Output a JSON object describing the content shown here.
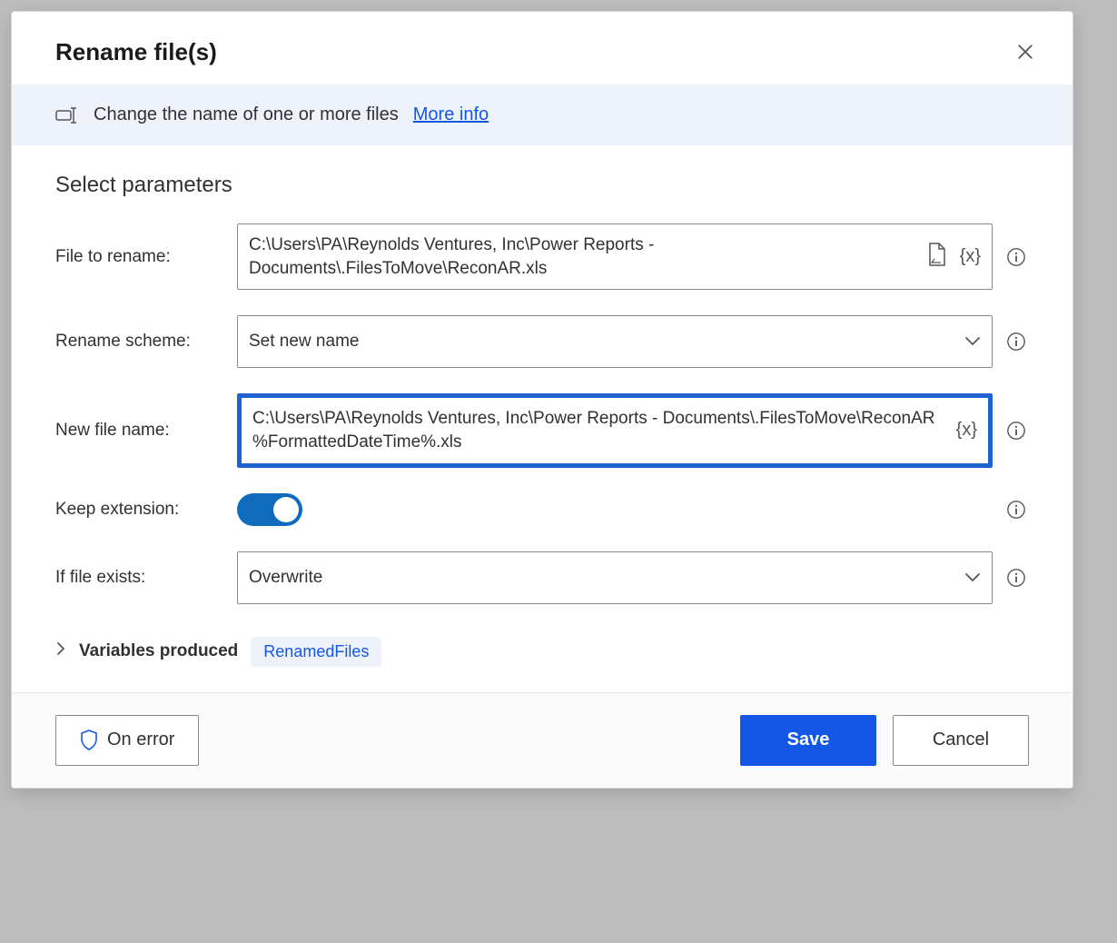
{
  "dialog": {
    "title": "Rename file(s)",
    "banner": {
      "text": "Change the name of one or more files",
      "link": "More info"
    },
    "section_title": "Select parameters",
    "fields": {
      "file_to_rename": {
        "label": "File to rename:",
        "value": "C:\\Users\\PA\\Reynolds Ventures, Inc\\Power Reports - Documents\\.FilesToMove\\ReconAR.xls",
        "var_token": "{x}"
      },
      "rename_scheme": {
        "label": "Rename scheme:",
        "value": "Set new name"
      },
      "new_file_name": {
        "label": "New file name:",
        "value": "C:\\Users\\PA\\Reynolds Ventures, Inc\\Power Reports - Documents\\.FilesToMove\\ReconAR %FormattedDateTime%.xls",
        "var_token": "{x}"
      },
      "keep_extension": {
        "label": "Keep extension:",
        "on": true
      },
      "if_file_exists": {
        "label": "If file exists:",
        "value": "Overwrite"
      }
    },
    "variables": {
      "label": "Variables produced",
      "chip": "RenamedFiles"
    },
    "footer": {
      "on_error": "On error",
      "save": "Save",
      "cancel": "Cancel"
    }
  },
  "icons": {
    "close": "close-icon",
    "rename": "rename-icon",
    "file_browse": "file-browse-icon",
    "variable": "variable-icon",
    "info": "info-icon",
    "chevron_down": "chevron-down-icon",
    "chevron_right": "chevron-right-icon",
    "shield": "shield-icon"
  }
}
